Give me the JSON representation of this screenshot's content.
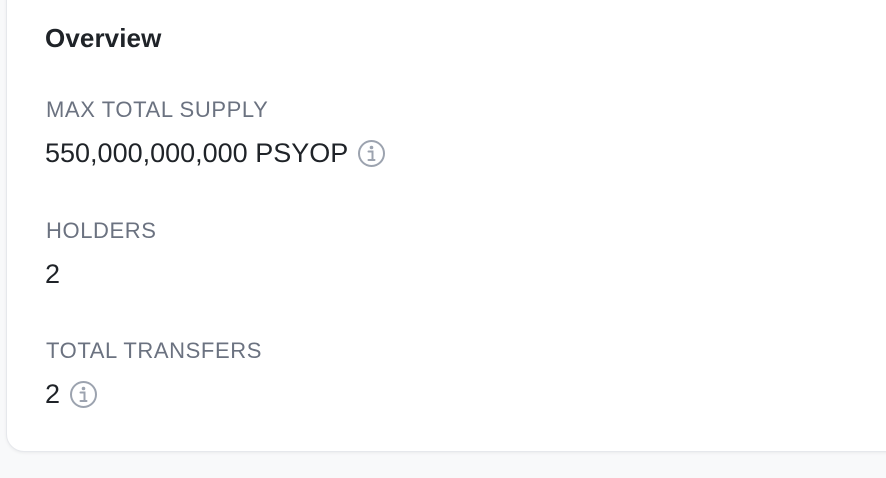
{
  "overview": {
    "title": "Overview",
    "max_total_supply": {
      "label": "MAX TOTAL SUPPLY",
      "value": "550,000,000,000 PSYOP",
      "icon": "info-icon"
    },
    "holders": {
      "label": "HOLDERS",
      "value": "2"
    },
    "total_transfers": {
      "label": "TOTAL TRANSFERS",
      "value": "2",
      "icon": "info-icon"
    }
  },
  "colors": {
    "text_primary": "#1f2328",
    "text_label": "#6b7280",
    "icon": "#9ca3af",
    "card_border": "#e6e8ec"
  }
}
